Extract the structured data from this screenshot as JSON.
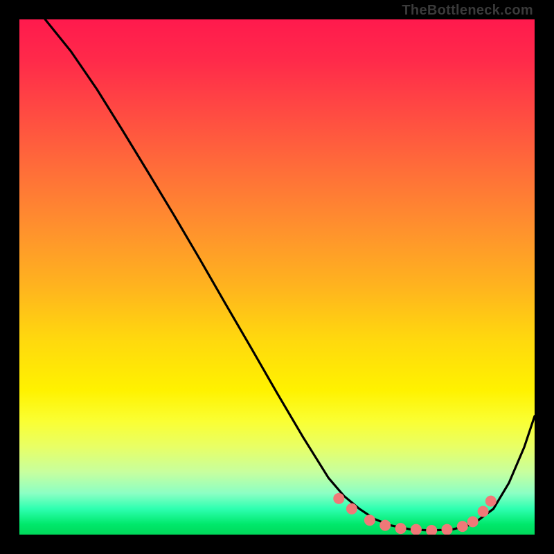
{
  "branding": "TheBottleneck.com",
  "chart_data": {
    "type": "line",
    "title": "",
    "xlabel": "",
    "ylabel": "",
    "xlim": [
      0,
      100
    ],
    "ylim": [
      0,
      100
    ],
    "grid": false,
    "legend": false,
    "series": [
      {
        "name": "curve",
        "x": [
          5,
          10,
          15,
          20,
          25,
          30,
          35,
          40,
          45,
          50,
          55,
          60,
          63,
          66,
          69,
          72,
          76,
          80,
          84,
          88,
          92,
          95,
          98,
          100
        ],
        "y": [
          100,
          93.8,
          86.5,
          78.5,
          70.3,
          62.0,
          53.5,
          44.8,
          36.2,
          27.5,
          19.0,
          11.0,
          7.5,
          5.0,
          3.0,
          1.8,
          1.0,
          0.8,
          1.0,
          2.0,
          5.0,
          10.0,
          17.0,
          23.0
        ]
      }
    ],
    "markers": {
      "name": "dots",
      "color": "#f07878",
      "radius_px": 8,
      "x": [
        62,
        64.5,
        68,
        71,
        74,
        77,
        80,
        83,
        86,
        88,
        90,
        91.5
      ],
      "y": [
        7.0,
        5.0,
        2.8,
        1.8,
        1.2,
        1.0,
        0.8,
        1.0,
        1.6,
        2.5,
        4.5,
        6.5
      ]
    },
    "colors": {
      "top": "#ff1a4d",
      "mid": "#ffe100",
      "bottom": "#00d85a",
      "line": "#000000",
      "marker": "#f07878"
    }
  }
}
